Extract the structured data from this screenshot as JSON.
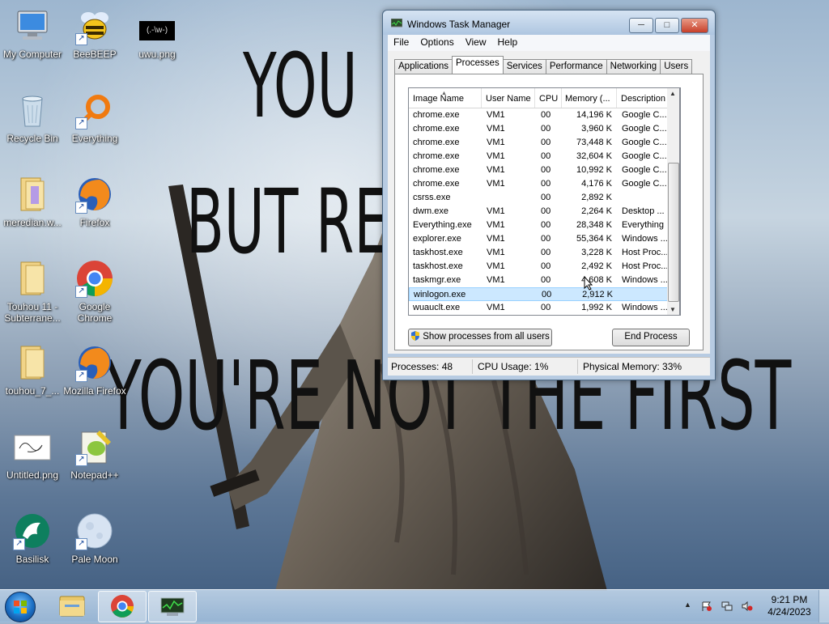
{
  "wallpaper": {
    "line1": "YOU",
    "line2": "BUT RE",
    "line3": "YOU'RE NOT THE FIRST"
  },
  "desktop_icons": [
    {
      "label": "My Computer",
      "icon": "computer-icon"
    },
    {
      "label": "BeeBEEP",
      "icon": "bee-icon"
    },
    {
      "label": "uwu.png",
      "icon": "image-thumbnail-icon",
      "thumb_text": "(.-\\w-)"
    },
    {
      "label": "Recycle Bin",
      "icon": "recycle-bin-icon"
    },
    {
      "label": "Everything",
      "icon": "everything-search-icon"
    },
    {
      "label": "meredian.w...",
      "icon": "folder-icon"
    },
    {
      "label": "Firefox",
      "icon": "firefox-icon"
    },
    {
      "label": "Touhou 11 - Subterrane...",
      "icon": "folder-icon"
    },
    {
      "label": "Google Chrome",
      "icon": "chrome-icon"
    },
    {
      "label": "touhou_7_...",
      "icon": "folder-icon"
    },
    {
      "label": "Mozilla Firefox",
      "icon": "firefox-icon"
    },
    {
      "label": "Untitled.png",
      "icon": "image-thumbnail-icon"
    },
    {
      "label": "Notepad++",
      "icon": "notepad-plus-plus-icon"
    },
    {
      "label": "Basilisk",
      "icon": "basilisk-icon"
    },
    {
      "label": "Pale Moon",
      "icon": "pale-moon-icon"
    }
  ],
  "taskmgr": {
    "title": "Windows Task Manager",
    "min_glyph": "─",
    "max_glyph": "□",
    "close_glyph": "✕",
    "menu": [
      "File",
      "Options",
      "View",
      "Help"
    ],
    "tabs": [
      "Applications",
      "Processes",
      "Services",
      "Performance",
      "Networking",
      "Users"
    ],
    "active_tab": "Processes",
    "columns": [
      "Image Name",
      "User Name",
      "CPU",
      "Memory (...",
      "Description"
    ],
    "sort_arrow": "▲",
    "rows": [
      {
        "name": "chrome.exe",
        "user": "VM1",
        "cpu": "00",
        "mem": "14,196 K",
        "desc": "Google C..."
      },
      {
        "name": "chrome.exe",
        "user": "VM1",
        "cpu": "00",
        "mem": "3,960 K",
        "desc": "Google C..."
      },
      {
        "name": "chrome.exe",
        "user": "VM1",
        "cpu": "00",
        "mem": "73,448 K",
        "desc": "Google C..."
      },
      {
        "name": "chrome.exe",
        "user": "VM1",
        "cpu": "00",
        "mem": "32,604 K",
        "desc": "Google C..."
      },
      {
        "name": "chrome.exe",
        "user": "VM1",
        "cpu": "00",
        "mem": "10,992 K",
        "desc": "Google C..."
      },
      {
        "name": "chrome.exe",
        "user": "VM1",
        "cpu": "00",
        "mem": "4,176 K",
        "desc": "Google C..."
      },
      {
        "name": "csrss.exe",
        "user": "",
        "cpu": "00",
        "mem": "2,892 K",
        "desc": ""
      },
      {
        "name": "dwm.exe",
        "user": "VM1",
        "cpu": "00",
        "mem": "2,264 K",
        "desc": "Desktop ..."
      },
      {
        "name": "Everything.exe",
        "user": "VM1",
        "cpu": "00",
        "mem": "28,348 K",
        "desc": "Everything"
      },
      {
        "name": "explorer.exe",
        "user": "VM1",
        "cpu": "00",
        "mem": "55,364 K",
        "desc": "Windows ..."
      },
      {
        "name": "taskhost.exe",
        "user": "VM1",
        "cpu": "00",
        "mem": "3,228 K",
        "desc": "Host Proc..."
      },
      {
        "name": "taskhost.exe",
        "user": "VM1",
        "cpu": "00",
        "mem": "2,492 K",
        "desc": "Host Proc..."
      },
      {
        "name": "taskmgr.exe",
        "user": "VM1",
        "cpu": "00",
        "mem": "4,608 K",
        "desc": "Windows ..."
      },
      {
        "name": "winlogon.exe",
        "user": "",
        "cpu": "00",
        "mem": "2,912 K",
        "desc": "",
        "selected": true
      },
      {
        "name": "wuauclt.exe",
        "user": "VM1",
        "cpu": "00",
        "mem": "1,992 K",
        "desc": "Windows ..."
      }
    ],
    "show_all_label": "Show processes from all users",
    "end_process_label": "End Process",
    "status": {
      "processes": "Processes: 48",
      "cpu": "CPU Usage: 1%",
      "memory": "Physical Memory: 33%"
    }
  },
  "taskbar": {
    "items": [
      {
        "icon": "windows-explorer-icon",
        "active": false
      },
      {
        "icon": "chrome-icon",
        "active": true
      },
      {
        "icon": "task-manager-icon",
        "active": true
      }
    ],
    "tray_arrow": "▲",
    "tray_icons": [
      "action-center-flag-icon",
      "network-icon",
      "speaker-muted-icon"
    ],
    "time": "9:21 PM",
    "date": "4/24/2023"
  }
}
